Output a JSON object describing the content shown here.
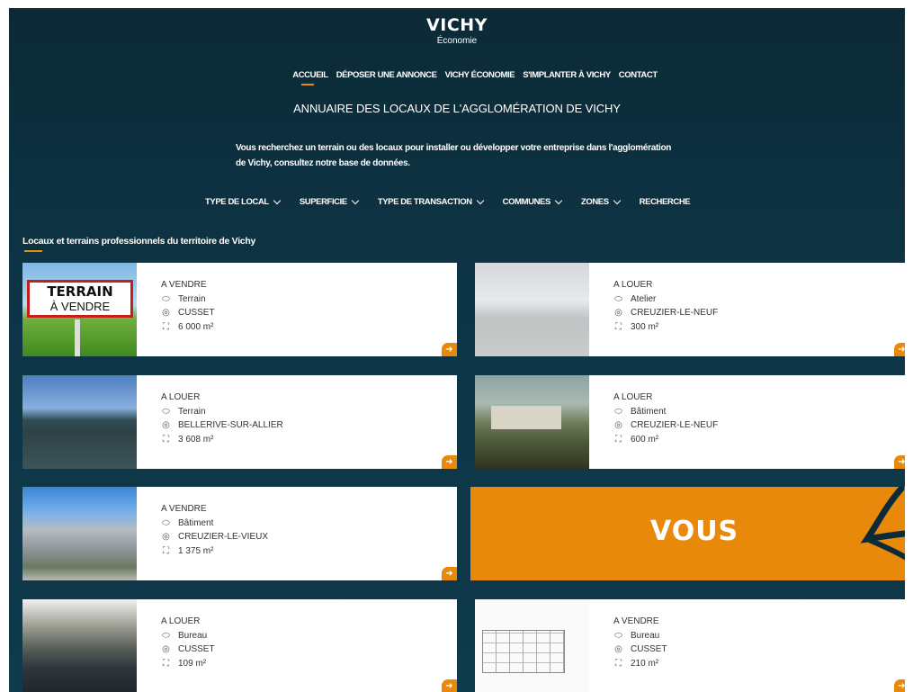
{
  "header": {
    "logo_title": "VICHY",
    "logo_subtitle": "Économie"
  },
  "nav": {
    "items": [
      {
        "label": "ACCUEIL",
        "active": true
      },
      {
        "label": "DÉPOSER UNE ANNONCE",
        "active": false
      },
      {
        "label": "VICHY ÉCONOMIE",
        "active": false
      },
      {
        "label": "S'IMPLANTER À VICHY",
        "active": false
      },
      {
        "label": "CONTACT",
        "active": false
      }
    ]
  },
  "page_title": "ANNUAIRE DES LOCAUX DE L'AGGLOMÉRATION DE VICHY",
  "intro": {
    "line1": "Vous recherchez un terrain ou des locaux pour installer ou développer votre entreprise dans l'agglomération",
    "line2": "de Vichy, consultez notre base de données."
  },
  "filters": [
    {
      "label": "TYPE DE LOCAL",
      "dropdown": true
    },
    {
      "label": "SUPERFICIE",
      "dropdown": true
    },
    {
      "label": "TYPE DE TRANSACTION",
      "dropdown": true
    },
    {
      "label": "COMMUNES",
      "dropdown": true
    },
    {
      "label": "ZONES",
      "dropdown": true
    },
    {
      "label": "RECHERCHE",
      "dropdown": false
    }
  ],
  "section_title": "Locaux et terrains professionnels du territoire de Vichy",
  "listings": [
    {
      "transaction": "A VENDRE",
      "type": "Terrain",
      "commune": "CUSSET",
      "surface": "6 000 m²",
      "photo": "terrain-sign",
      "sign_line1": "TERRAIN",
      "sign_line2": "À VENDRE"
    },
    {
      "transaction": "A LOUER",
      "type": "Atelier",
      "commune": "CREUZIER-LE-NEUF",
      "surface": "300 m²",
      "photo": "atelier"
    },
    {
      "transaction": "A LOUER",
      "type": "Terrain",
      "commune": "BELLERIVE-SUR-ALLIER",
      "surface": "3 608 m²",
      "photo": "terrain-lac"
    },
    {
      "transaction": "A LOUER",
      "type": "Bâtiment",
      "commune": "CREUZIER-LE-NEUF",
      "surface": "600 m²",
      "photo": "batiment"
    },
    {
      "transaction": "A VENDRE",
      "type": "Bâtiment",
      "commune": "CREUZIER-LE-VIEUX",
      "surface": "1 375 m²",
      "photo": "batiment"
    },
    {
      "transaction": "A LOUER",
      "type": "Bureau",
      "commune": "CUSSET",
      "surface": "109 m²",
      "photo": "bureau"
    },
    {
      "transaction": "A VENDRE",
      "type": "Bureau",
      "commune": "CUSSET",
      "surface": "210 m²",
      "photo": "plan"
    }
  ],
  "promo": {
    "text": "VOUS"
  },
  "icons": {
    "type": "tag-icon",
    "commune": "location-pin-icon",
    "surface": "area-expand-icon",
    "arrow": "arrow-right-icon",
    "chevron": "chevron-down-icon"
  },
  "colors": {
    "background": "#0d3445",
    "accent": "#e8890c",
    "card": "#ffffff"
  }
}
